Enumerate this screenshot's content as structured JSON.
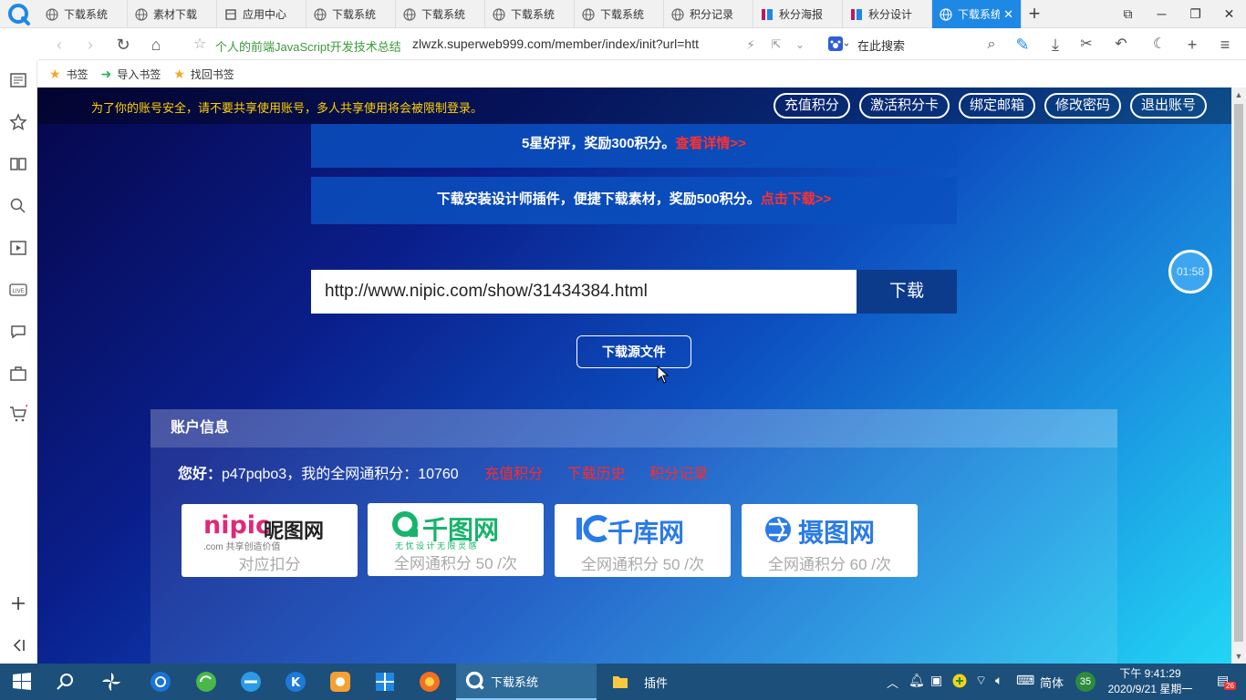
{
  "browser": {
    "tabs": [
      {
        "label": "下载系统",
        "icon": "globe-icon"
      },
      {
        "label": "素材下载",
        "icon": "globe-icon"
      },
      {
        "label": "应用中心",
        "icon": "app-icon"
      },
      {
        "label": "下载系统",
        "icon": "globe-icon"
      },
      {
        "label": "下载系统",
        "icon": "globe-icon"
      },
      {
        "label": "下载系统",
        "icon": "globe-icon"
      },
      {
        "label": "下载系统",
        "icon": "globe-icon"
      },
      {
        "label": "积分记录",
        "icon": "globe-icon"
      },
      {
        "label": "秋分海报",
        "icon": "brand-icon"
      },
      {
        "label": "秋分设计",
        "icon": "brand-icon"
      },
      {
        "label": "下载系统",
        "icon": "globe-icon",
        "active": true
      }
    ],
    "page_title": "个人的前端JavaScript开发技术总结",
    "url": "zlwzk.superweb999.com/member/index/init?url=htt",
    "search_placeholder": "在此搜索",
    "bookmarks": [
      {
        "label": "书签",
        "icon": "star-icon"
      },
      {
        "label": "导入书签",
        "icon": "import-icon"
      },
      {
        "label": "找回书签",
        "icon": "star-icon"
      }
    ],
    "accent": "#1e88e5"
  },
  "page": {
    "notice": "为了你的账号安全，请不要共享使用账号，多人共享使用将会被限制登录。",
    "account_buttons": [
      "充值积分",
      "激活积分卡",
      "绑定邮箱",
      "修改密码",
      "退出账号"
    ],
    "promo1_text": "5星好评，奖励300积分。",
    "promo1_link": "查看详情>>",
    "promo2_text": "下载安装设计师插件，便捷下载素材，奖励500积分。",
    "promo2_link": "点击下载>>",
    "url_input_value": "http://www.nipic.com/show/31434384.html",
    "download_label": "下载",
    "source_button": "下载源文件",
    "timer": "01:58",
    "account": {
      "header": "账户信息",
      "greeting": "您好：",
      "line": "p47pqbo3，我的全网通积分：10760",
      "links": [
        "充值积分",
        "下载历史",
        "积分记录"
      ]
    },
    "sites": [
      {
        "brand": "nipic",
        "brand2": "昵图网",
        "sub": ".com  共享创造价值",
        "points": "对应扣分"
      },
      {
        "brand": "千图网",
        "sub": "无 忧 设 计   无 限 灵 感",
        "points": "全网通积分 50 /次"
      },
      {
        "brand": "千库网",
        "points": "全网通积分 50 /次"
      },
      {
        "brand": "摄图网",
        "points": "全网通积分 60 /次"
      }
    ]
  },
  "taskbar": {
    "tasks": [
      {
        "label": "下载系统",
        "active": true
      },
      {
        "label": "插件",
        "active": false
      }
    ],
    "ime": "简体",
    "badge": "35",
    "notifications": "26",
    "time": "下午 9:41:29",
    "date": "2020/9/21 星期一"
  }
}
